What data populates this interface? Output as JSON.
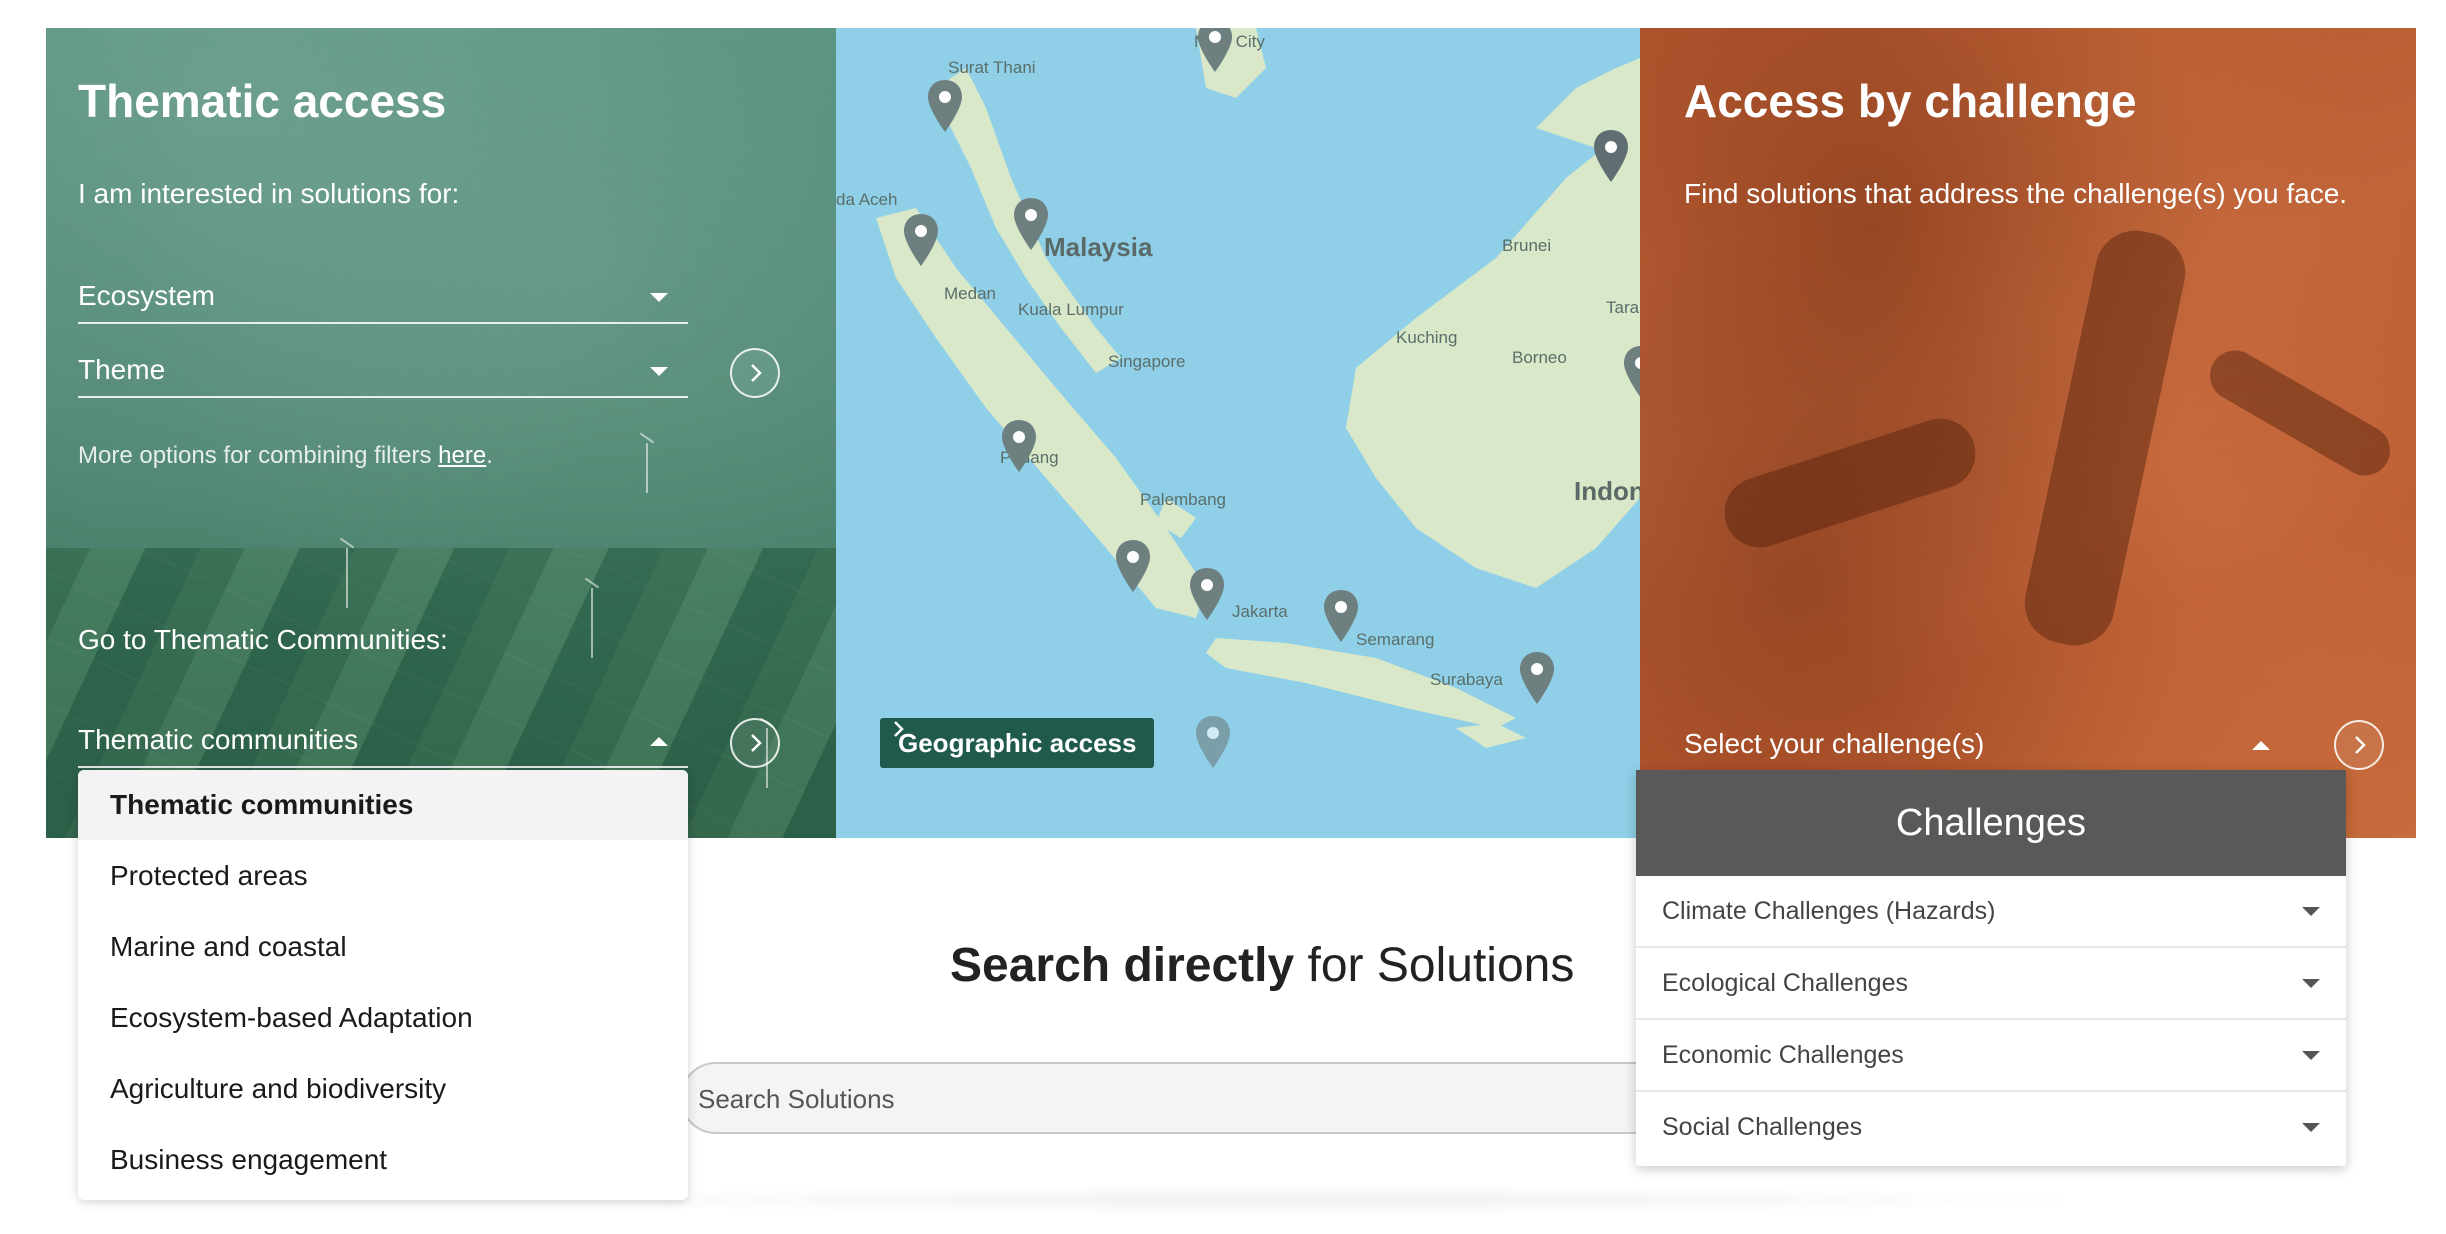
{
  "thematic": {
    "title": "Thematic access",
    "intro": "I am interested in solutions for:",
    "ecosystem_select": "Ecosystem",
    "theme_select": "Theme",
    "more_options_text": "More options for combining filters ",
    "more_options_link": "here",
    "more_options_end": ".",
    "communities_heading": "Go to Thematic Communities:",
    "communities_select": "Thematic communities",
    "go_icon": "chevron-right-icon"
  },
  "communities_dropdown": {
    "items": [
      "Thematic communities",
      "Protected areas",
      "Marine and coastal",
      "Ecosystem-based Adaptation",
      "Agriculture and biodiversity",
      "Business engagement"
    ]
  },
  "map": {
    "labels": {
      "minh_city": "Minh City",
      "surat_thani": "Surat Thani",
      "banda_aceh": "da Aceh",
      "malaysia": "Malaysia",
      "medan": "Medan",
      "kuala_lumpur": "Kuala Lumpur",
      "singapore": "Singapore",
      "padang": "Padang",
      "palembang": "Palembang",
      "jakarta": "Jakarta",
      "semarang": "Semarang",
      "surabaya": "Surabaya",
      "brunei": "Brunei",
      "kuching": "Kuching",
      "borneo": "Borneo",
      "tara": "Tara",
      "indon": "Indon"
    },
    "geographic_button": "Geographic access",
    "colors": {
      "sea": "#8fd0e8",
      "land": "#d9e8c8",
      "pin": "#6e7f80"
    }
  },
  "challenge": {
    "title": "Access by challenge",
    "intro": "Find solutions that address the challenge(s) you face.",
    "select": "Select your challenge(s)"
  },
  "challenges_panel": {
    "header": "Challenges",
    "rows": [
      "Climate Challenges (Hazards)",
      "Ecological Challenges",
      "Economic Challenges",
      "Social Challenges"
    ]
  },
  "search": {
    "title_bold": "Search directly",
    "title_rest": " for Solutions",
    "placeholder": "Search Solutions"
  },
  "colors": {
    "thematic_green": "#3f7a66",
    "challenge_orange": "#c0643a",
    "geo_button": "#1f5a4c",
    "challenges_header": "#595959"
  }
}
